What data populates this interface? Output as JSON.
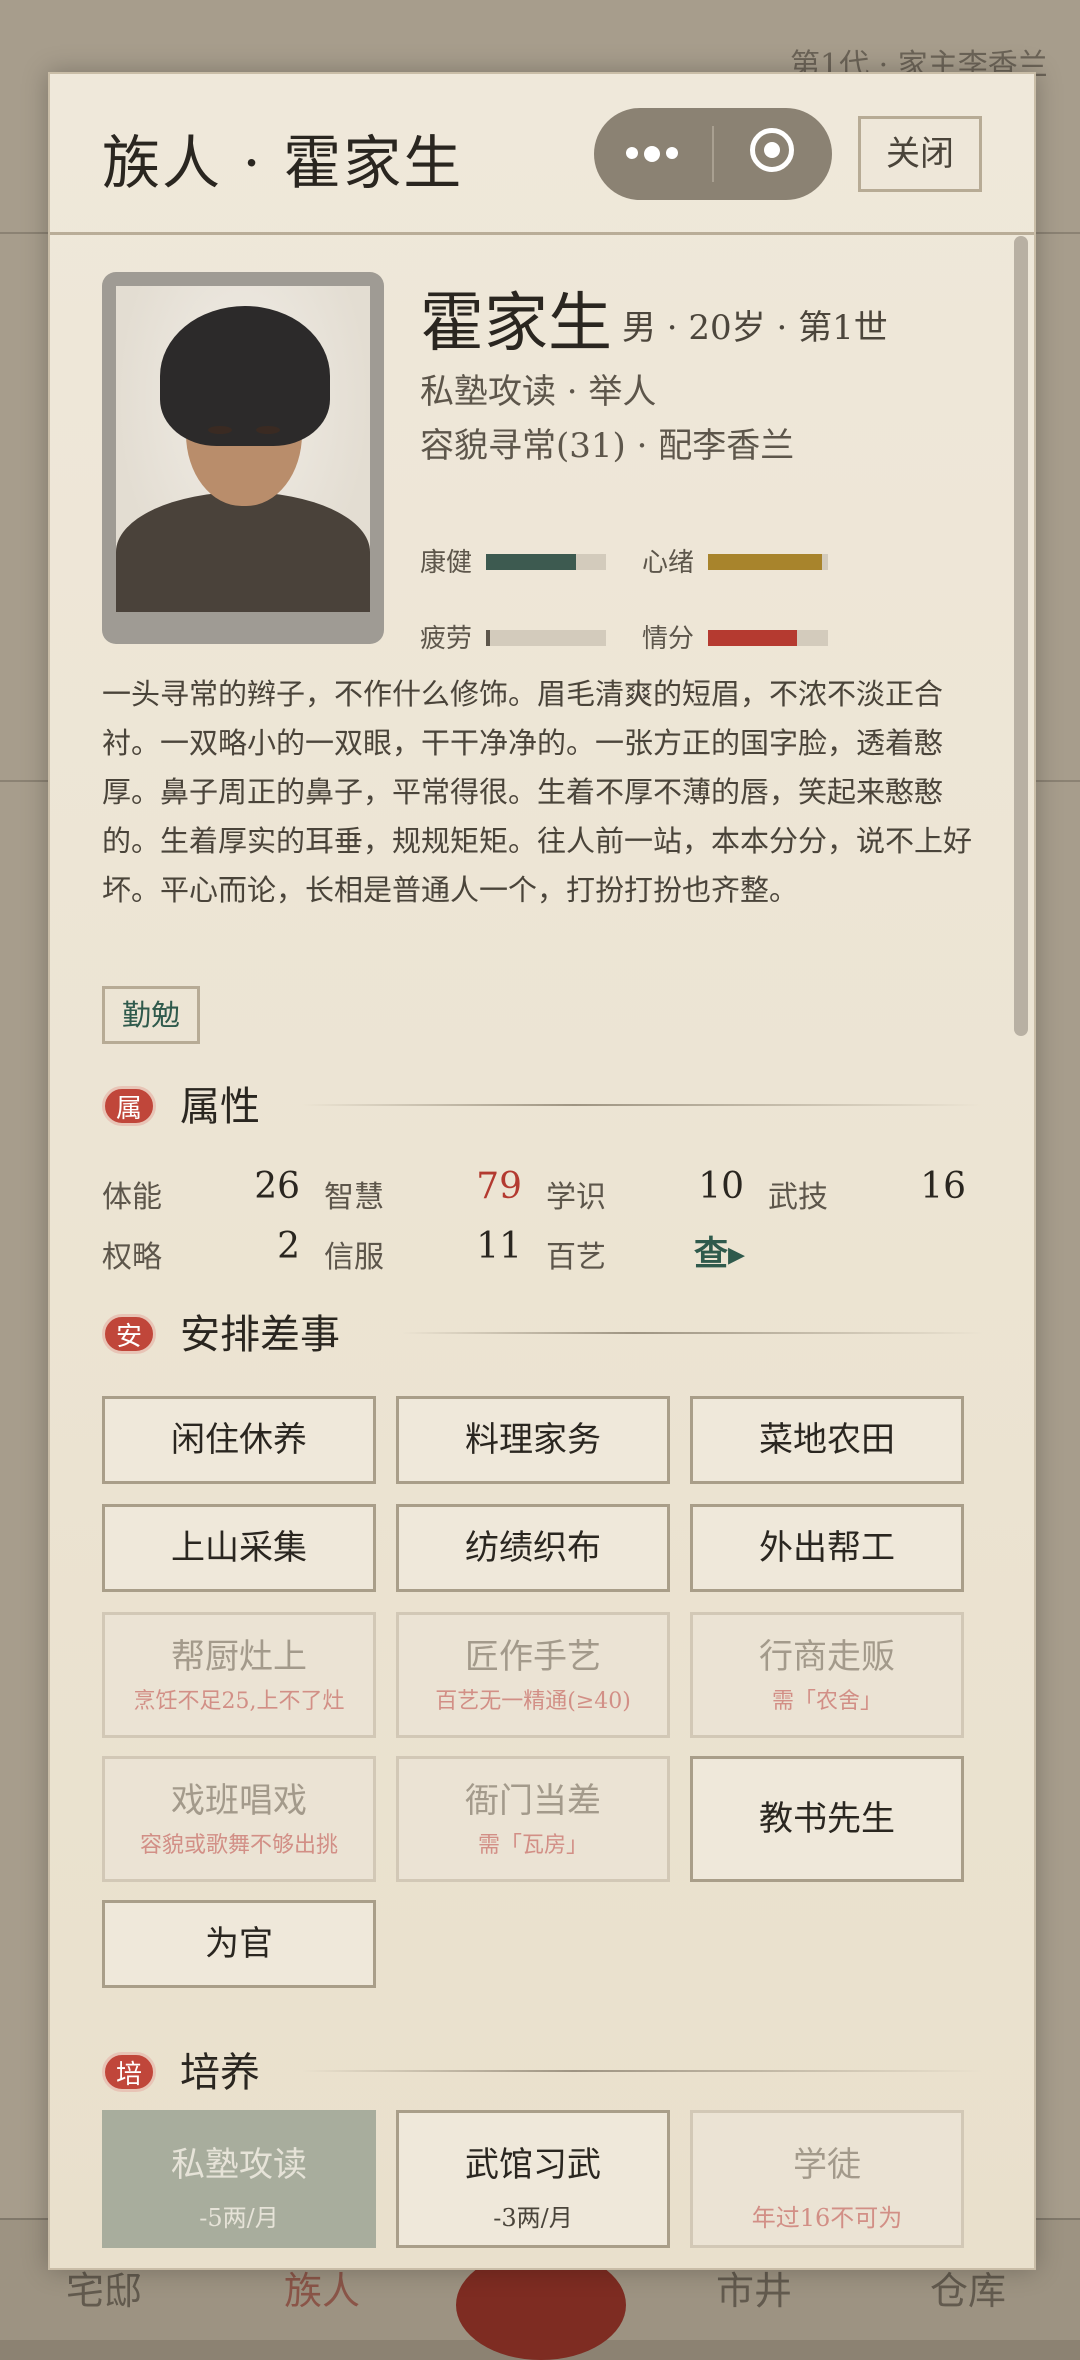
{
  "background": {
    "top_right": "第1代 · 家主李香兰",
    "nav": [
      "宅邸",
      "族人",
      "市井",
      "仓库"
    ]
  },
  "modal": {
    "title": "族人 · 霍家生",
    "close_label": "关闭"
  },
  "profile": {
    "name": "霍家生",
    "meta": "男 · 20岁 · 第1世",
    "line1": "私塾攻读 · 举人",
    "line2": "容貌寻常(31) · 配李香兰",
    "stats": [
      {
        "label": "康健",
        "value": 0.75,
        "color": "#3d5a50"
      },
      {
        "label": "心绪",
        "value": 0.95,
        "color": "#a8842c"
      },
      {
        "label": "疲劳",
        "value": 0.03,
        "color": "#5d564b"
      },
      {
        "label": "情分",
        "value": 0.74,
        "color": "#b53a30"
      }
    ]
  },
  "description": "一头寻常的辫子，不作什么修饰。眉毛清爽的短眉，不浓不淡正合衬。一双略小的一双眼，干干净净的。一张方正的国字脸，透着憨厚。鼻子周正的鼻子，平常得很。生着不厚不薄的唇，笑起来憨憨的。生着厚实的耳垂，规规矩矩。往人前一站，本本分分，说不上好坏。平心而论，长相是普通人一个，打扮打扮也齐整。",
  "trait_tag": "勤勉",
  "sections": {
    "attributes": {
      "badge": "属",
      "title": "属性"
    },
    "jobs": {
      "badge": "安",
      "title": "安排差事"
    },
    "training": {
      "badge": "培",
      "title": "培养"
    }
  },
  "attributes": [
    {
      "label": "体能",
      "value": "26"
    },
    {
      "label": "智慧",
      "value": "79"
    },
    {
      "label": "学识",
      "value": "10"
    },
    {
      "label": "武技",
      "value": "16"
    },
    {
      "label": "权略",
      "value": "2"
    },
    {
      "label": "信服",
      "value": "11"
    },
    {
      "label": "百艺",
      "value": "查▸"
    }
  ],
  "jobs": [
    {
      "label": "闲住休养"
    },
    {
      "label": "料理家务"
    },
    {
      "label": "菜地农田"
    },
    {
      "label": "上山采集"
    },
    {
      "label": "纺绩织布"
    },
    {
      "label": "外出帮工"
    },
    {
      "label": "帮厨灶上",
      "note": "烹饪不足25,上不了灶"
    },
    {
      "label": "匠作手艺",
      "note": "百艺无一精通(≥40)"
    },
    {
      "label": "行商走贩",
      "note": "需「农舍」"
    },
    {
      "label": "戏班唱戏",
      "note": "容貌或歌舞不够出挑"
    },
    {
      "label": "衙门当差",
      "note": "需「瓦房」"
    },
    {
      "label": "教书先生"
    },
    {
      "label": "为官"
    }
  ],
  "training": [
    {
      "label": "私塾攻读",
      "cost": "-5两/月"
    },
    {
      "label": "武馆习武",
      "cost": "-3两/月"
    },
    {
      "label": "学徒",
      "cost": "年过16不可为"
    }
  ]
}
